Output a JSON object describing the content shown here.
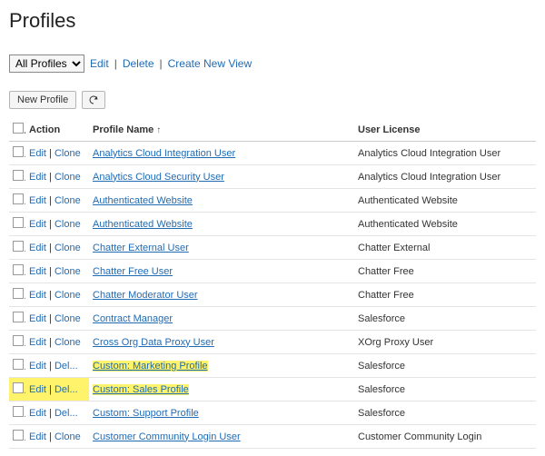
{
  "title": "Profiles",
  "view": {
    "selected": "All Profiles",
    "links": {
      "edit": "Edit",
      "delete": "Delete",
      "create": "Create New View"
    }
  },
  "toolbar": {
    "new_profile": "New Profile"
  },
  "columns": {
    "action": "Action",
    "profile_name": "Profile Name",
    "user_license": "User License"
  },
  "actions": {
    "edit": "Edit",
    "clone": "Clone",
    "del": "Del..."
  },
  "rows": [
    {
      "name": "Analytics Cloud Integration User",
      "license": "Analytics Cloud Integration User",
      "act2": "clone",
      "highlight": ""
    },
    {
      "name": "Analytics Cloud Security User",
      "license": "Analytics Cloud Integration User",
      "act2": "clone",
      "highlight": ""
    },
    {
      "name": "Authenticated Website",
      "license": "Authenticated Website",
      "act2": "clone",
      "highlight": ""
    },
    {
      "name": "Authenticated Website",
      "license": "Authenticated Website",
      "act2": "clone",
      "highlight": ""
    },
    {
      "name": "Chatter External User",
      "license": "Chatter External",
      "act2": "clone",
      "highlight": ""
    },
    {
      "name": "Chatter Free User",
      "license": "Chatter Free",
      "act2": "clone",
      "highlight": ""
    },
    {
      "name": "Chatter Moderator User",
      "license": "Chatter Free",
      "act2": "clone",
      "highlight": ""
    },
    {
      "name": "Contract Manager",
      "license": "Salesforce",
      "act2": "clone",
      "highlight": ""
    },
    {
      "name": "Cross Org Data Proxy User",
      "license": "XOrg Proxy User",
      "act2": "clone",
      "highlight": ""
    },
    {
      "name": "Custom: Marketing Profile",
      "license": "Salesforce",
      "act2": "del",
      "highlight": "name"
    },
    {
      "name": "Custom: Sales Profile",
      "license": "Salesforce",
      "act2": "del",
      "highlight": "row"
    },
    {
      "name": "Custom: Support Profile",
      "license": "Salesforce",
      "act2": "del",
      "highlight": ""
    },
    {
      "name": "Customer Community Login User",
      "license": "Customer Community Login",
      "act2": "clone",
      "highlight": ""
    }
  ]
}
